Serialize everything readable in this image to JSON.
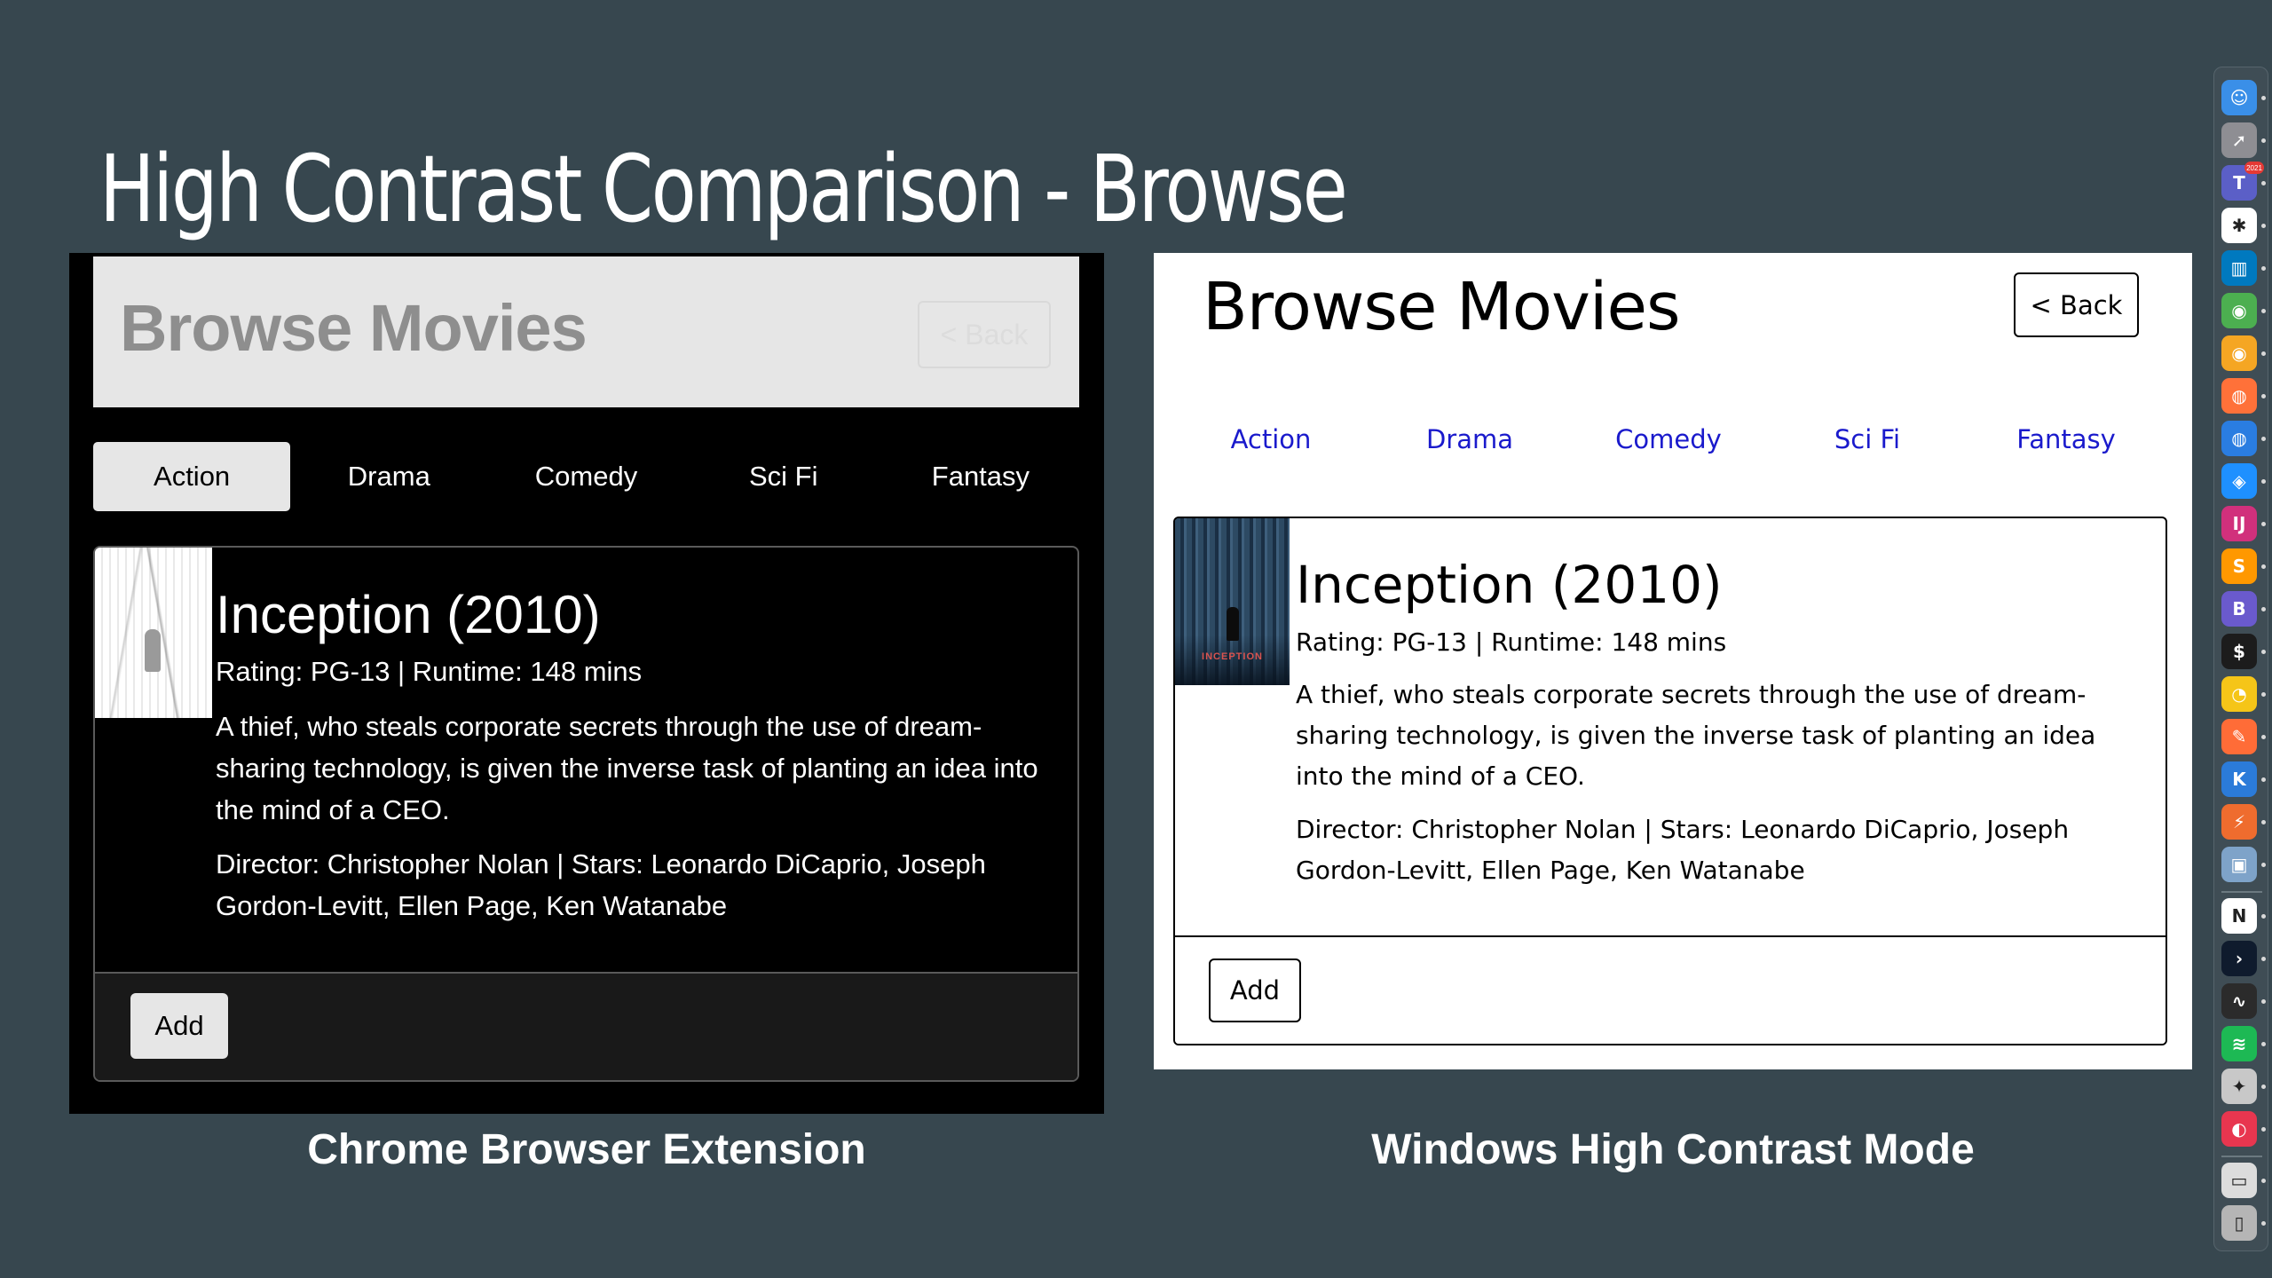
{
  "slide": {
    "title": "High Contrast Comparison - Browse"
  },
  "left_panel": {
    "caption": "Chrome Browser Extension",
    "header_title": "Browse Movies",
    "back_label": "< Back",
    "tabs": [
      {
        "label": "Action",
        "active": true
      },
      {
        "label": "Drama",
        "active": false
      },
      {
        "label": "Comedy",
        "active": false
      },
      {
        "label": "Sci Fi",
        "active": false
      },
      {
        "label": "Fantasy",
        "active": false
      }
    ],
    "movie": {
      "title": "Inception (2010)",
      "meta": "Rating: PG-13 | Runtime: 148 mins",
      "description": "A thief, who steals corporate secrets through the use of dream-sharing technology, is given the inverse task of planting an idea into the mind of a CEO.",
      "credits": "Director: Christopher Nolan | Stars: Leonardo DiCaprio, Joseph Gordon-Levitt, Ellen Page, Ken Watanabe"
    },
    "add_label": "Add"
  },
  "right_panel": {
    "caption": "Windows High Contrast Mode",
    "header_title": "Browse Movies",
    "back_label": "< Back",
    "tabs": [
      {
        "label": "Action"
      },
      {
        "label": "Drama"
      },
      {
        "label": "Comedy"
      },
      {
        "label": "Sci Fi"
      },
      {
        "label": "Fantasy"
      }
    ],
    "movie": {
      "title": "Inception (2010)",
      "meta": "Rating: PG-13 | Runtime: 148 mins",
      "description": "A thief, who steals corporate secrets through the use of dream-sharing technology, is given the inverse task of planting an idea into the mind of a CEO.",
      "credits": "Director: Christopher Nolan | Stars: Leonardo DiCaprio, Joseph Gordon-Levitt, Ellen Page, Ken Watanabe",
      "poster_text": "INCEPTION"
    },
    "add_label": "Add"
  },
  "colors": {
    "slide_background": "#37474f",
    "link_blue": "#1a1acc",
    "dark_background": "#000000",
    "light_gray": "#e6e6e6"
  },
  "dock": {
    "items": [
      {
        "name": "finder-icon",
        "color": "#3a8fe8",
        "glyph": "☺"
      },
      {
        "name": "launchpad-icon",
        "color": "#8e8e93",
        "glyph": "➚"
      },
      {
        "name": "teams-icon",
        "color": "#5b5fc7",
        "glyph": "T",
        "badge": "2021"
      },
      {
        "name": "slack-icon",
        "color": "#ffffff",
        "glyph": "✱"
      },
      {
        "name": "trello-icon",
        "color": "#0079bf",
        "glyph": "▥"
      },
      {
        "name": "chrome-icon",
        "color": "#4caf50",
        "glyph": "◉"
      },
      {
        "name": "chrome-canary-icon",
        "color": "#f5a623",
        "glyph": "◉"
      },
      {
        "name": "firefox-icon",
        "color": "#ff7139",
        "glyph": "◍"
      },
      {
        "name": "firefox-developer-icon",
        "color": "#2a7de1",
        "glyph": "◍"
      },
      {
        "name": "safari-icon",
        "color": "#1e90ff",
        "glyph": "◈"
      },
      {
        "name": "intellij-icon",
        "color": "#d1307c",
        "glyph": "IJ"
      },
      {
        "name": "sublime-text-icon",
        "color": "#ff9800",
        "glyph": "S"
      },
      {
        "name": "bbedit-icon",
        "color": "#6a5acd",
        "glyph": "B"
      },
      {
        "name": "terminal-icon",
        "color": "#1c1c1c",
        "glyph": "$"
      },
      {
        "name": "cyberduck-icon",
        "color": "#f5c518",
        "glyph": "◔"
      },
      {
        "name": "postman-icon",
        "color": "#ff6c37",
        "glyph": "✎"
      },
      {
        "name": "kaleidoscope-icon",
        "color": "#2b7bd9",
        "glyph": "K"
      },
      {
        "name": "sourcetree-icon",
        "color": "#ef6c2e",
        "glyph": "⚡"
      },
      {
        "name": "virtualbox-icon",
        "color": "#7ea3c9",
        "glyph": "▣"
      },
      {
        "name": "notion-icon",
        "color": "#ffffff",
        "glyph": "N"
      },
      {
        "name": "vscode-remote-icon",
        "color": "#0f1b2d",
        "glyph": "›"
      },
      {
        "name": "activity-monitor-icon",
        "color": "#2b2b2b",
        "glyph": "∿"
      },
      {
        "name": "spotify-icon",
        "color": "#1db954",
        "glyph": "≋"
      },
      {
        "name": "disk-utility-icon",
        "color": "#c8c8c8",
        "glyph": "✦"
      },
      {
        "name": "speeko-icon",
        "color": "#e8364f",
        "glyph": "◐"
      },
      {
        "name": "downloads-folder-icon",
        "color": "#dcdcdc",
        "glyph": "▭"
      },
      {
        "name": "trash-icon",
        "color": "#b5b5b5",
        "glyph": "▯"
      }
    ]
  }
}
